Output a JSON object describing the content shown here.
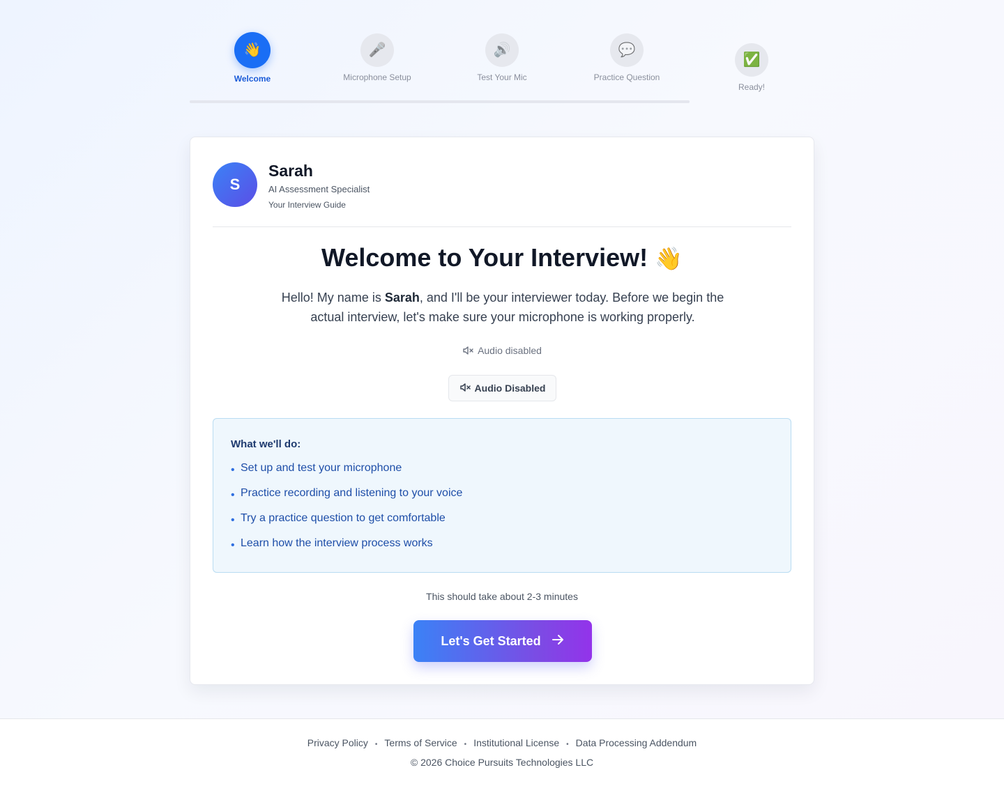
{
  "stepper": {
    "steps": [
      {
        "label": "Welcome",
        "icon": "waving-hand-icon",
        "glyph": "👋",
        "state": "active"
      },
      {
        "label": "Microphone Setup",
        "icon": "microphone-icon",
        "glyph": "🎤",
        "state": "upcoming"
      },
      {
        "label": "Test Your Mic",
        "icon": "speaker-icon",
        "glyph": "🔊",
        "state": "upcoming"
      },
      {
        "label": "Practice Question",
        "icon": "speech-bubble-icon",
        "glyph": "💬",
        "state": "upcoming"
      },
      {
        "label": "Ready!",
        "icon": "check-mark-icon",
        "glyph": "✅",
        "state": "upcoming"
      }
    ]
  },
  "profile": {
    "initial": "S",
    "name": "Sarah",
    "role": "AI Assessment Specialist",
    "guide": "Your Interview Guide"
  },
  "welcome": {
    "title": "Welcome to Your Interview!",
    "title_emoji": "👋",
    "intro_before": "Hello! My name is ",
    "intro_name": "Sarah",
    "intro_after": ", and I'll be your interviewer today. Before we begin the actual interview, let's make sure your microphone is working properly."
  },
  "audio": {
    "status_text": "Audio disabled",
    "button_label": "Audio Disabled"
  },
  "plan": {
    "title": "What we'll do:",
    "items": [
      "Set up and test your microphone",
      "Practice recording and listening to your voice",
      "Try a practice question to get comfortable",
      "Learn how the interview process works"
    ]
  },
  "duration_text": "This should take about 2-3 minutes",
  "start_button": {
    "label": "Let's Get Started"
  },
  "footer": {
    "links": [
      "Privacy Policy",
      "Terms of Service",
      "Institutional License",
      "Data Processing Addendum"
    ],
    "separator": "•",
    "copyright": "© 2026 Choice Pursuits Technologies LLC"
  },
  "colors": {
    "accent": "#1a6ef5",
    "button_gradient_start": "#3b82f6",
    "button_gradient_end": "#9333ea",
    "plan_background": "#eff7fd",
    "plan_border": "#b9dcf2"
  }
}
